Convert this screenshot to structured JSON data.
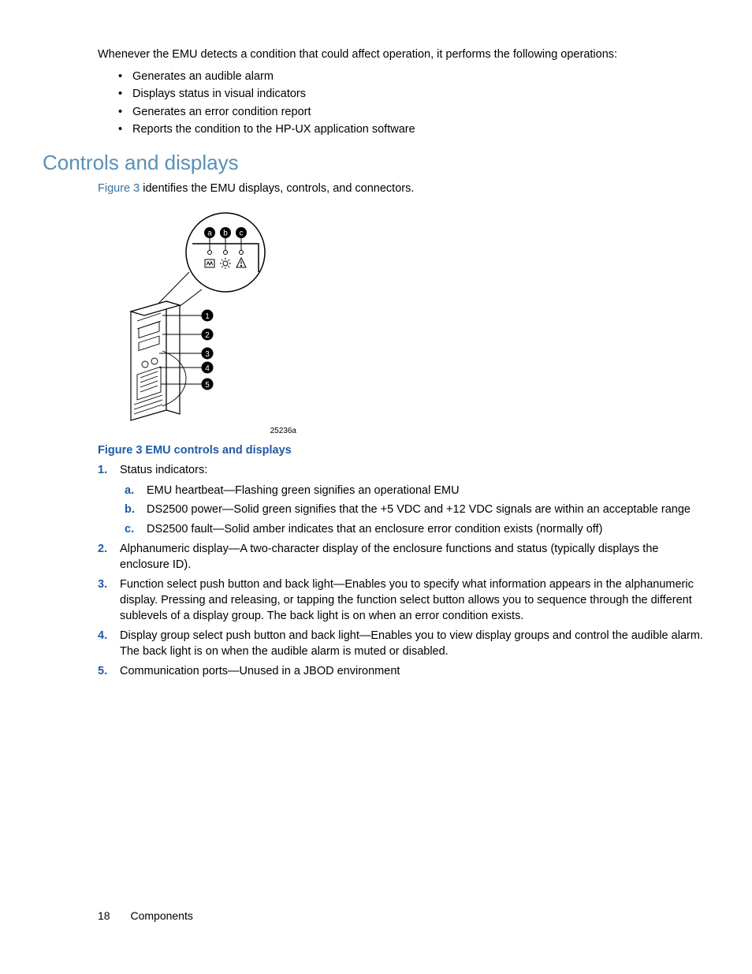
{
  "intro": "Whenever the EMU detects a condition that could affect operation, it performs the following operations:",
  "bullets": [
    "Generates an audible alarm",
    "Displays status in visual indicators",
    "Generates an error condition report",
    "Reports the condition to the HP-UX application software"
  ],
  "section_heading": "Controls and displays",
  "section_body_pre": "Figure 3",
  "section_body_post": " identifies the EMU displays, controls, and connectors.",
  "figure_id": "25236a",
  "figure_caption": "Figure 3 EMU controls and displays",
  "numlist": [
    {
      "marker": "1.",
      "text": "Status indicators:",
      "subitems": [
        {
          "marker": "a.",
          "text": "EMU heartbeat—Flashing green signifies an operational EMU"
        },
        {
          "marker": "b.",
          "text": "DS2500 power—Solid green signifies that the +5 VDC and +12 VDC signals are within an acceptable range"
        },
        {
          "marker": "c.",
          "text": "DS2500 fault—Solid amber indicates that an enclosure error condition exists (normally off)"
        }
      ]
    },
    {
      "marker": "2.",
      "text": "Alphanumeric display—A two-character display of the enclosure functions and status (typically displays the enclosure ID)."
    },
    {
      "marker": "3.",
      "text": "Function select push button and back light—Enables you to specify what information appears in the alphanumeric display. Pressing and releasing, or tapping the function select button allows you to sequence through the different sublevels of a display group. The back light is on when an error condition exists."
    },
    {
      "marker": "4.",
      "text": "Display group select push button and back light—Enables you to view display groups and control the audible alarm. The back light is on when the audible alarm is muted or disabled."
    },
    {
      "marker": "5.",
      "text": "Communication ports—Unused in a JBOD environment"
    }
  ],
  "footer": {
    "page": "18",
    "section": "Components"
  },
  "callouts": {
    "top": [
      "a",
      "b",
      "c"
    ],
    "side": [
      "1",
      "2",
      "3",
      "4",
      "5"
    ]
  }
}
